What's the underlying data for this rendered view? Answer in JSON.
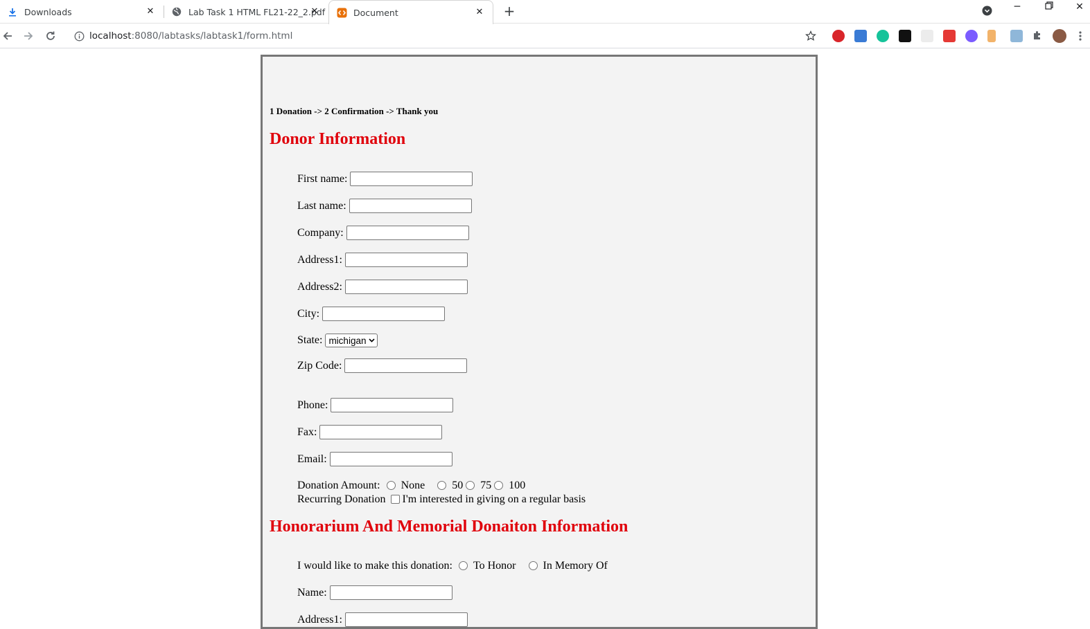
{
  "browser": {
    "tabs": [
      {
        "title": "Downloads",
        "icon": "download-icon",
        "active": false
      },
      {
        "title": "Lab Task 1 HTML FL21-22_2.pdf",
        "icon": "globe-icon",
        "active": false
      },
      {
        "title": "Document",
        "icon": "html-file-icon",
        "active": true
      }
    ],
    "url_host": "localhost",
    "url_path": ":8080/labtasks/labtask1/form.html"
  },
  "form": {
    "steps": "1 Donation -> 2 Confirmation -> Thank you",
    "donor_heading": "Donor Information",
    "labels": {
      "first_name": "First name:",
      "last_name": "Last name:",
      "company": "Company:",
      "address1": "Address1:",
      "address2": "Address2:",
      "city": "City:",
      "state": "State:",
      "zip": "Zip Code:",
      "phone": "Phone:",
      "fax": "Fax:",
      "email": "Email:"
    },
    "state_value": "michigan",
    "donation_amount_label": "Donation Amount:",
    "donation_options": [
      "None",
      "50",
      "75",
      "100"
    ],
    "recurring_label": "Recurring Donation",
    "recurring_text": "I'm interested in giving on a regular basis",
    "honor_heading": "Honorarium And Memorial Donaiton Information",
    "make_donation_label": "I would like to make this donation:",
    "honor_options": [
      "To Honor",
      "In Memory Of"
    ],
    "honor_name_label": "Name:",
    "honor_address1_label": "Address1:"
  },
  "colors": {
    "heading": "#e0000b",
    "form_bg": "#f3f3f3",
    "form_border": "#777777"
  }
}
